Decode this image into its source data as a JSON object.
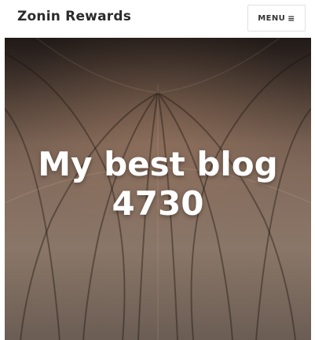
{
  "header": {
    "site_title": "Zonin Rewards",
    "menu_label": "MENU",
    "menu_icon": "hamburger-icon",
    "menu_glyph": "≡"
  },
  "hero": {
    "title": "My best blog 4730",
    "background": "church-vaulted-ceiling-photo"
  }
}
